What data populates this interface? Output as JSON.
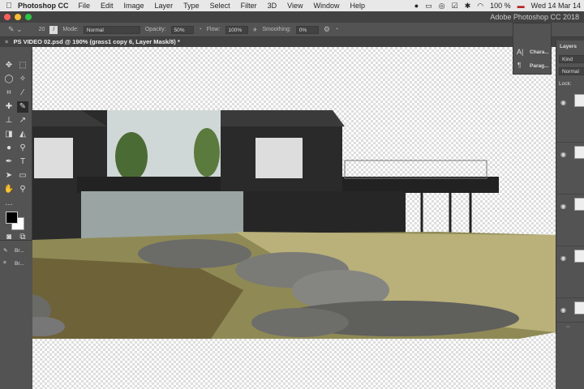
{
  "menubar": {
    "app": "Photoshop CC",
    "items": [
      "File",
      "Edit",
      "Image",
      "Layer",
      "Type",
      "Select",
      "Filter",
      "3D",
      "View",
      "Window",
      "Help"
    ],
    "battery": "100 %",
    "datetime": "Wed 14 Mar 14"
  },
  "window": {
    "title": "Adobe Photoshop CC 2018"
  },
  "options": {
    "brush_size": "20",
    "mode_label": "Mode:",
    "mode": "Normal",
    "opacity_label": "Opacity:",
    "opacity": "50%",
    "flow_label": "Flow:",
    "flow": "100%",
    "smoothing_label": "Smoothing:",
    "smoothing": "0%"
  },
  "document_tab": {
    "title": "PS VIDEO 02.psd @ 190% (grass1 copy 6, Layer Mask/8) *"
  },
  "float_panel": {
    "items": [
      "Chara...",
      "Parag..."
    ]
  },
  "toolbox": {
    "bottom_items": [
      "Br...",
      "Br..."
    ]
  },
  "layers": {
    "tab": "Layers",
    "filter": "Kind",
    "blend": "Normal",
    "lock_label": "Lock:"
  },
  "colors": {
    "accent": "#535353",
    "foreground": "#000000",
    "background": "#ffffff"
  }
}
